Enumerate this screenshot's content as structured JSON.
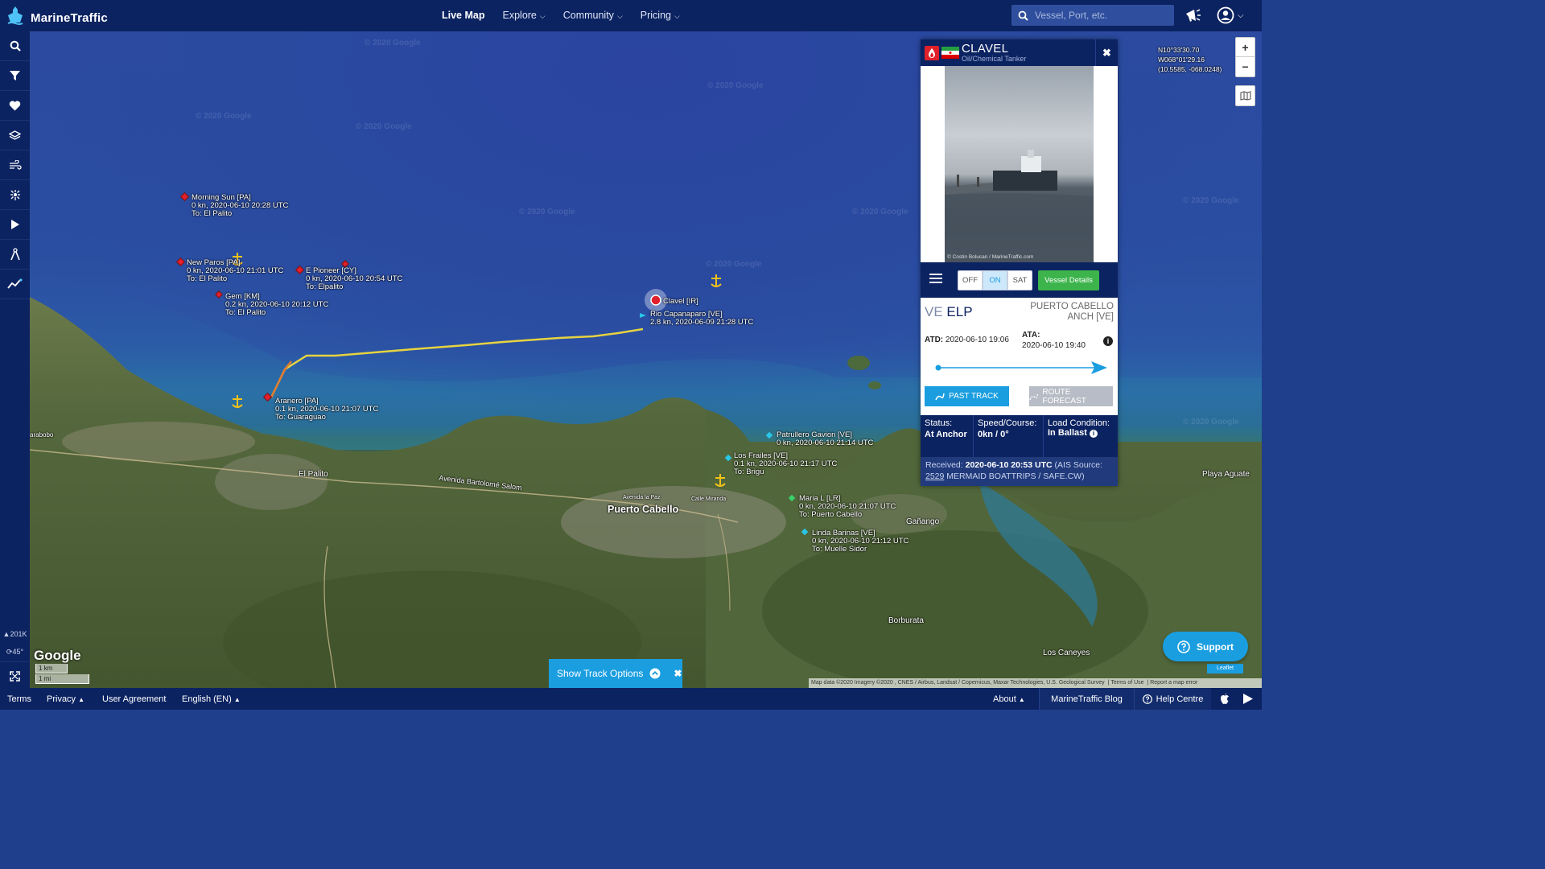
{
  "topbar": {
    "app_name": "MarineTraffic",
    "nav": [
      {
        "label": "Live Map",
        "dropdown": false
      },
      {
        "label": "Explore",
        "dropdown": true
      },
      {
        "label": "Community",
        "dropdown": true
      },
      {
        "label": "Pricing",
        "dropdown": true
      }
    ],
    "search_placeholder": "Vessel, Port, etc."
  },
  "leftbar": {
    "icons": [
      "search-icon",
      "filter-icon",
      "heart-icon",
      "layers-icon",
      "wind-icon",
      "density-icon",
      "play-icon",
      "measure-icon",
      "chart-icon"
    ],
    "count": "201K",
    "rotation": "45°"
  },
  "map": {
    "coords": {
      "lat": "N10°33'30.70",
      "lon": "W068°01'29.16",
      "decimal": "(10.5585, -068.0248)"
    },
    "vessels": [
      {
        "name": "Morning Sun [PA]",
        "speed_time": "0 kn, 2020-06-10 20:28 UTC",
        "dest": "To: El Palito",
        "color": "#e0202a"
      },
      {
        "name": "New Paros [PA]",
        "speed_time": "0 kn, 2020-06-10 21:01 UTC",
        "dest": "To: El Palito",
        "color": "#e0202a"
      },
      {
        "name": "E Pioneer [CY]",
        "speed_time": "0 kn, 2020-06-10 20:54 UTC",
        "dest": "To: Elpalito",
        "color": "#e0202a"
      },
      {
        "name": "Gem [KM]",
        "speed_time": "0.2 kn, 2020-06-10 20:12 UTC",
        "dest": "To: El Palito",
        "color": "#e0202a"
      },
      {
        "name": "Clavel [IR]",
        "speed_time": "",
        "dest": "",
        "color": "#e0202a"
      },
      {
        "name": "Rio Capanaparo [VE]",
        "speed_time": "2.8 kn, 2020-06-09 21:28 UTC",
        "dest": "",
        "color": "#28c6e8"
      },
      {
        "name": "Aranero [PA]",
        "speed_time": "0.1 kn, 2020-06-10 21:07 UTC",
        "dest": "To: Guaraguao",
        "color": "#e0202a"
      },
      {
        "name": "Patrullero Gavion [VE]",
        "speed_time": "0 kn, 2020-06-10 21:14 UTC",
        "dest": "",
        "color": "#28c6e8"
      },
      {
        "name": "Los Frailes [VE]",
        "speed_time": "0.1 kn, 2020-06-10 21:17 UTC",
        "dest": "To: Brigu",
        "color": "#28c6e8"
      },
      {
        "name": "Maria L [LR]",
        "speed_time": "0 kn, 2020-06-10 21:07 UTC",
        "dest": "To: Puerto Cabello",
        "color": "#3ad06a"
      },
      {
        "name": "Linda Barinas [VE]",
        "speed_time": "0 kn, 2020-06-10 21:12 UTC",
        "dest": "To: Muelle Sidor",
        "color": "#28c6e8"
      }
    ],
    "places": {
      "el_palito": "El Palito",
      "puerto_cabello": "Puerto Cabello",
      "avenida": "Avenida Bartolomé Salom",
      "ganango": "Gañango",
      "borburata": "Borburata",
      "los_caneyes": "Los Caneyes",
      "playa_aguate": "Playa Aguate",
      "morón": "arabobo",
      "avenida_la_paz": "Avenida la Paz",
      "calle_miranda": "Calle Miranda"
    },
    "watermark": "© 2020 Google",
    "google_logo": "Google",
    "scale_km": "1 km",
    "scale_mi": "1 mi",
    "attribution": "Map data ©2020 Imagery ©2020 , CNES / Airbus, Landsat / Copernicus, Maxar Technologies, U.S. Geological Survey",
    "terms_of_use": "Terms of Use",
    "report_error": "Report a map error",
    "leaflet": "Leaflet"
  },
  "vessel_panel": {
    "name": "CLAVEL",
    "type": "Oil/Chemical Tanker",
    "photo_credit": "© Costin Bolucan / MarineTraffic.com",
    "toggle": [
      "OFF",
      "ON",
      "SAT"
    ],
    "toggle_active": "ON",
    "details_button": "Vessel Details",
    "origin_country": "VE",
    "origin_port": "ELP",
    "destination": "PUERTO CABELLO ANCH [VE]",
    "atd_label": "ATD:",
    "atd_value": "2020-06-10 19:06",
    "ata_label": "ATA:",
    "ata_value": "2020-06-10 19:40",
    "past_track": "PAST TRACK",
    "route_forecast": "ROUTE FORECAST",
    "status_label": "Status:",
    "status_value": "At Anchor",
    "speed_label": "Speed/Course:",
    "speed_value": "0kn / 0°",
    "load_label": "Load Condition:",
    "load_value": "In Ballast",
    "received_label": "Received:",
    "received_value": "2020-06-10 20:53 UTC",
    "ais_prefix": "(AIS Source:",
    "ais_id": "2529",
    "ais_name": "MERMAID BOATTRIPS / SAFE.CW)",
    "progress": 1.0
  },
  "show_track": "Show Track Options",
  "support": "Support",
  "footer": {
    "terms": "Terms",
    "privacy": "Privacy",
    "user_agreement": "User Agreement",
    "language": "English (EN)",
    "about": "About",
    "blog": "MarineTraffic Blog",
    "help": "Help Centre"
  },
  "colors": {
    "navy": "#0c2361",
    "accent": "#1a9ee0",
    "green": "#3cb44b"
  }
}
